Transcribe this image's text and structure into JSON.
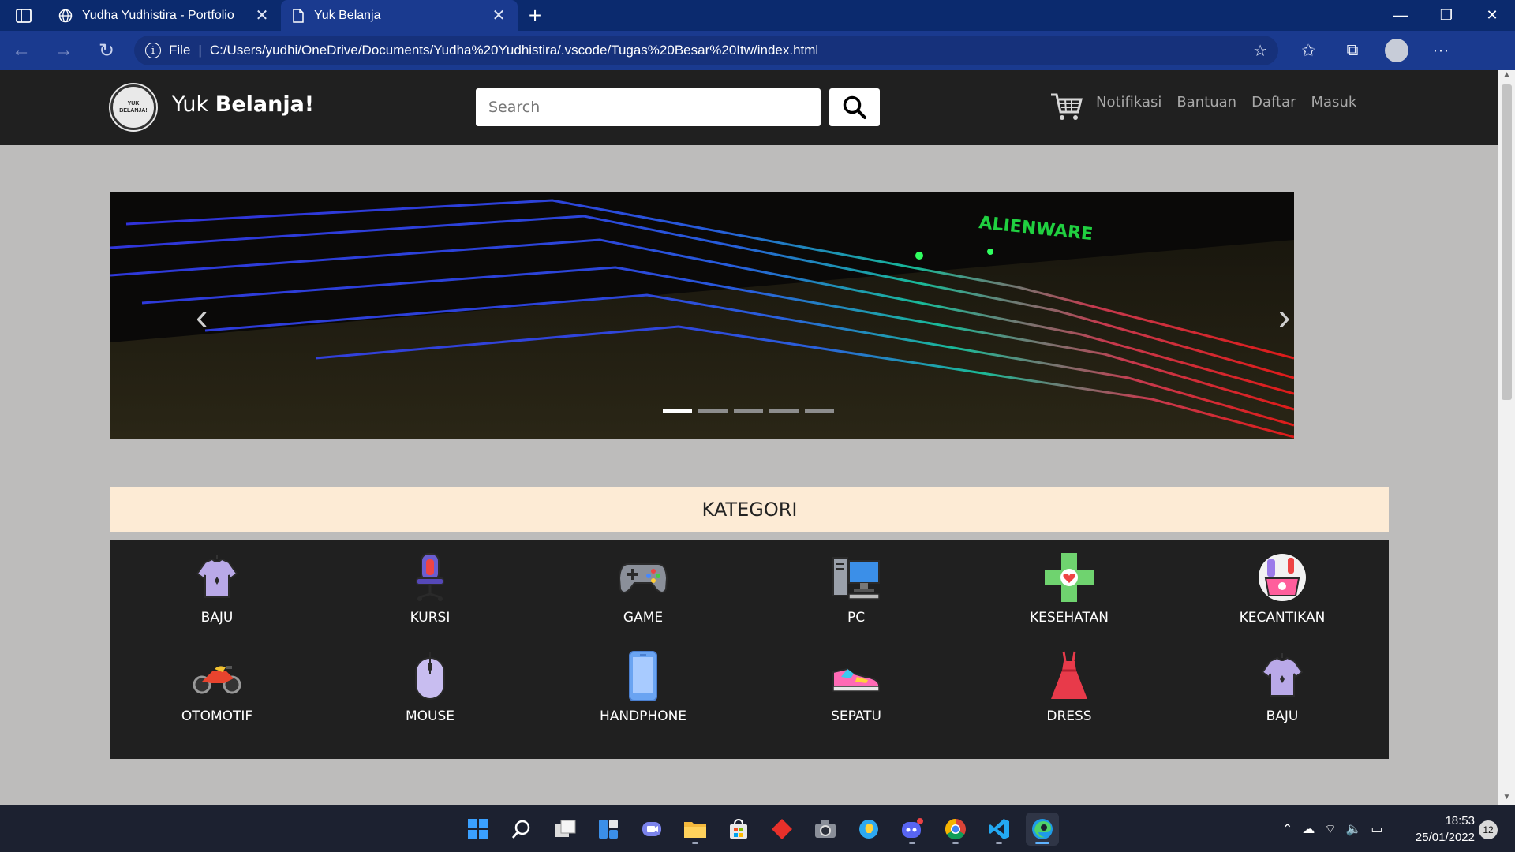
{
  "browser": {
    "tabs": [
      {
        "title": "Yudha Yudhistira - Portfolio",
        "active": false
      },
      {
        "title": "Yuk Belanja",
        "active": true
      }
    ],
    "new_tab": "+",
    "address": {
      "scheme_label": "File",
      "url": "C:/Users/yudhi/OneDrive/Documents/Yudha%20Yudhistira/.vscode/Tugas%20Besar%20Itw/index.html"
    }
  },
  "site": {
    "logo_text": "YUK BELANJA!",
    "brand_prefix": "Yuk ",
    "brand_bold": "Belanja!",
    "search_placeholder": "Search",
    "nav": [
      "Notifikasi",
      "Bantuan",
      "Daftar",
      "Masuk"
    ],
    "carousel": {
      "slide_count": 5,
      "active_index": 0
    },
    "kategori_title": "KATEGORI",
    "categories": [
      {
        "label": "BAJU",
        "icon": "shirt-icon"
      },
      {
        "label": "KURSI",
        "icon": "gaming-chair-icon"
      },
      {
        "label": "GAME",
        "icon": "gamepad-icon"
      },
      {
        "label": "PC",
        "icon": "desktop-pc-icon"
      },
      {
        "label": "KESEHATAN",
        "icon": "health-cross-icon"
      },
      {
        "label": "KECANTIKAN",
        "icon": "cosmetics-icon"
      },
      {
        "label": "OTOMOTIF",
        "icon": "motorbike-icon"
      },
      {
        "label": "MOUSE",
        "icon": "mouse-icon"
      },
      {
        "label": "HANDPHONE",
        "icon": "smartphone-icon"
      },
      {
        "label": "SEPATU",
        "icon": "sneaker-icon"
      },
      {
        "label": "DRESS",
        "icon": "dress-icon"
      },
      {
        "label": "BAJU",
        "icon": "shirt-icon"
      }
    ]
  },
  "taskbar": {
    "time": "18:53",
    "date": "25/01/2022",
    "notifications": "12"
  },
  "colors": {
    "tabbar": "#0b2a6e",
    "toolbar": "#1a3a8f",
    "site_header": "#202020",
    "page_bg": "#bdbcbb",
    "kategori_bar": "#fdebd5"
  }
}
